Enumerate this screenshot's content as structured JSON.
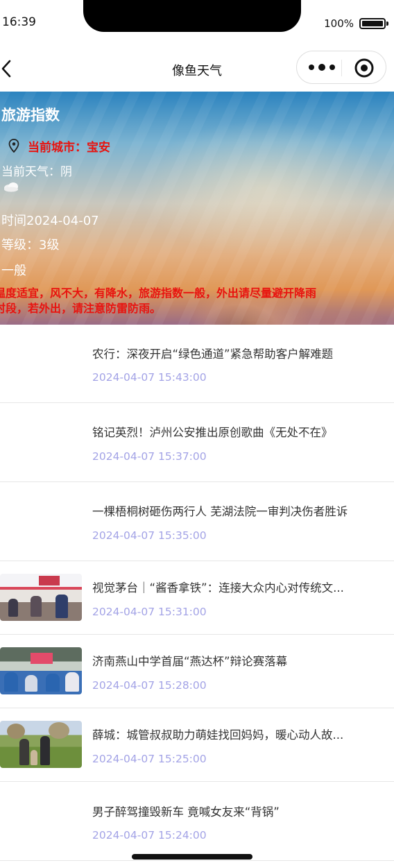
{
  "status_bar": {
    "time": "16:39",
    "battery_percent": "100%",
    "battery_level": 1.0
  },
  "nav": {
    "title": "像鱼天气",
    "back_icon": "chevron-left-icon",
    "more_icon": "more-dots-icon",
    "close_icon": "target-circle-icon"
  },
  "banner": {
    "title": "旅游指数",
    "city": "当前城市：宝安",
    "weather": "当前天气：阴",
    "weather_icon": "cloud-icon",
    "time": "时间2024-04-07",
    "level": "等级：3级",
    "description": "一般",
    "advice_line1": "温度适宜，风不大，有降水，旅游指数一般，外出请尽量避开降雨",
    "advice_line2": "时段，若外出，请注意防雷防雨。",
    "colors": {
      "highlight": "#e8130f"
    }
  },
  "news": [
    {
      "title": "农行：深夜开启“绿色通道”紧急帮助客户解难题",
      "time": "2024-04-07 15:43:00",
      "thumbnail": ""
    },
    {
      "title": "铭记英烈！泸州公安推出原创歌曲《无处不在》",
      "time": "2024-04-07 15:37:00",
      "thumbnail": ""
    },
    {
      "title": "一棵梧桐树砸伤两行人 芜湖法院一审判决伤者胜诉",
      "time": "2024-04-07 15:35:00",
      "thumbnail": ""
    },
    {
      "title": "视觉茅台｜“酱香拿铁”：连接大众内心对传统文...",
      "time": "2024-04-07 15:31:00",
      "thumbnail": "photo-people-indoors"
    },
    {
      "title": "济南燕山中学首届“燕达杯”辩论赛落幕",
      "time": "2024-04-07 15:28:00",
      "thumbnail": "photo-classroom"
    },
    {
      "title": "薛城：城管叔叔助力萌娃找回妈妈，暖心动人故...",
      "time": "2024-04-07 15:25:00",
      "thumbnail": "photo-outdoor-park"
    },
    {
      "title": "男子醉驾撞毁新车 竟喊女友来“背锅”",
      "time": "2024-04-07 15:24:00",
      "thumbnail": ""
    }
  ],
  "colors": {
    "time_text": "#a3a3e6",
    "title_text": "#333333"
  }
}
